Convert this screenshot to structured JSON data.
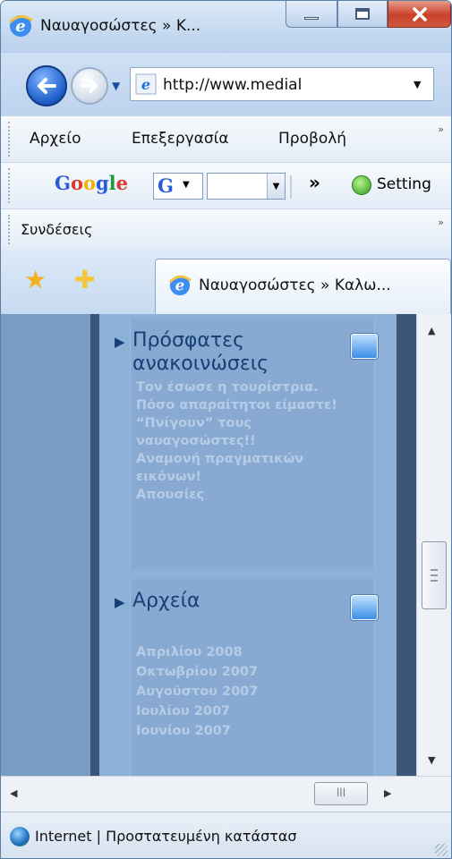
{
  "window": {
    "title": "Ναυαγοσώστες » Κ..."
  },
  "address": {
    "url": "http://www.medial"
  },
  "menubar": {
    "items": [
      "Αρχείο",
      "Επεξεργασία",
      "Προβολή"
    ],
    "more": "»"
  },
  "google_toolbar": {
    "logo": "Google",
    "search_icon": "G",
    "overflow": "»",
    "settings_label": "Setting"
  },
  "links_bar": {
    "label": "Συνδέσεις",
    "more": "»"
  },
  "tab": {
    "title": "Ναυαγοσώστες » Καλω..."
  },
  "content": {
    "recent": {
      "heading_line1": "Πρόσφατες",
      "heading_line2": "ανακοινώσεις",
      "items": [
        "Τον έσωσε η τουρίστρια.",
        "Πόσο απαραίτητοι είμαστε!",
        "“Πνίγουν” τους",
        "ναυαγοσώστες!!",
        "Αναμονή πραγματικών",
        "εικόνων!",
        "Απουσίες"
      ]
    },
    "archive": {
      "heading": "Αρχεία",
      "items": [
        "Απριλίου 2008",
        "Οκτωβρίου 2007",
        "Αυγούστου 2007",
        "Ιουλίου 2007",
        "Ιουνίου 2007"
      ]
    }
  },
  "status": {
    "text": "Internet | Προστατευμένη κατάστασ"
  },
  "colors": {
    "accent": "#163f76",
    "link": "#b6cce6",
    "panel": "#8cb0d8"
  }
}
